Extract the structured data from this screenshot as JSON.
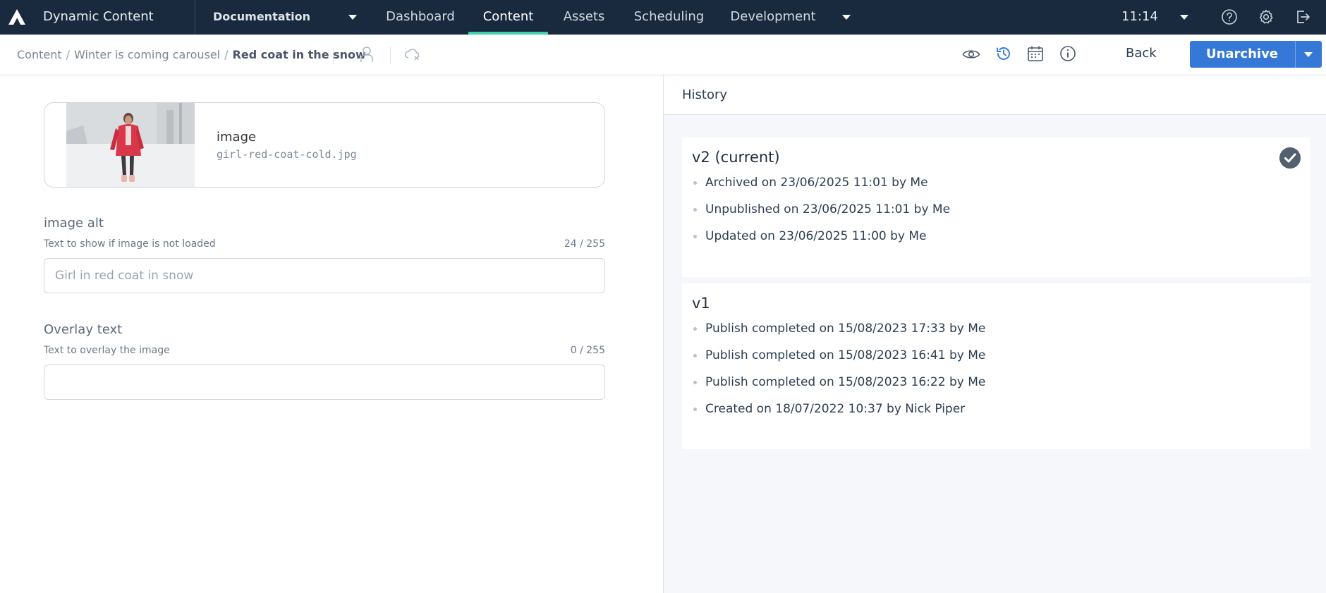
{
  "topbar": {
    "app_name": "Dynamic Content",
    "hub": "Documentation",
    "tabs": [
      {
        "label": "Dashboard",
        "active": false
      },
      {
        "label": "Content",
        "active": true
      },
      {
        "label": "Assets",
        "active": false
      },
      {
        "label": "Scheduling",
        "active": false
      },
      {
        "label": "Development",
        "active": false
      }
    ],
    "time": "11:14",
    "icons": [
      "help-icon",
      "settings-icon",
      "logout-icon"
    ],
    "accent_color": "#40d1a8",
    "background_color": "#192a3e"
  },
  "toolbar": {
    "breadcrumb": [
      "Content",
      "Winter is coming carousel",
      "Red coat in the snow"
    ],
    "icons": [
      "user-icon",
      "cloud-off-icon",
      "preview-eye-icon",
      "history-icon",
      "calendar-icon",
      "info-icon"
    ],
    "back_label": "Back",
    "primary_label": "Unarchive",
    "primary_color": "#3578d8"
  },
  "form": {
    "image": {
      "title": "image",
      "filename": "girl-red-coat-cold.jpg"
    },
    "image_alt": {
      "label": "image alt",
      "help": "Text to show if image is not loaded",
      "count": "24 / 255",
      "placeholder": "Girl in red coat in snow",
      "value": ""
    },
    "overlay_text": {
      "label": "Overlay text",
      "help": "Text to overlay the image",
      "count": "0 / 255",
      "placeholder": "",
      "value": ""
    }
  },
  "history": {
    "title": "History",
    "versions": [
      {
        "title": "v2 (current)",
        "current": true,
        "entries": [
          "Archived on 23/06/2025 11:01 by Me",
          "Unpublished on 23/06/2025 11:01 by Me",
          "Updated on 23/06/2025 11:00 by Me"
        ]
      },
      {
        "title": "v1",
        "current": false,
        "entries": [
          "Publish completed on 15/08/2023 17:33 by Me",
          "Publish completed on 15/08/2023 16:41 by Me",
          "Publish completed on 15/08/2023 16:22 by Me",
          "Created on 18/07/2022 10:37 by Nick Piper"
        ]
      }
    ]
  }
}
